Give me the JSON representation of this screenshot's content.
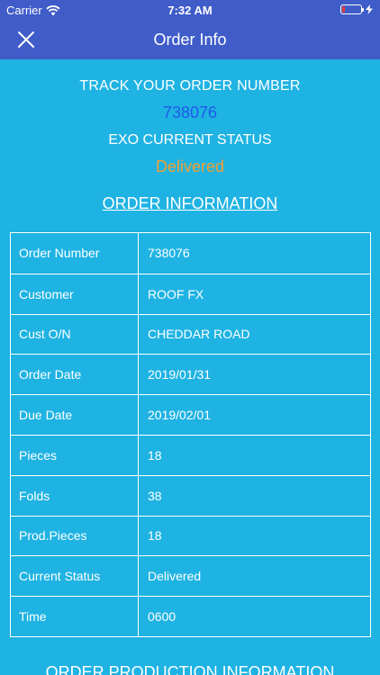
{
  "status_bar": {
    "carrier": "Carrier",
    "time": "7:32 AM",
    "battery_level": 0.15,
    "icons": [
      "wifi-icon",
      "battery-icon",
      "charging-icon"
    ]
  },
  "nav": {
    "title": "Order Info",
    "close_icon": "close-icon"
  },
  "tracking": {
    "label": "TRACK YOUR ORDER NUMBER",
    "number": "738076",
    "status_label": "EXO CURRENT STATUS",
    "status_value": "Delivered"
  },
  "order_info": {
    "title": "ORDER INFORMATION",
    "rows": [
      {
        "label": "Order Number",
        "value": "738076"
      },
      {
        "label": "Customer",
        "value": "ROOF FX"
      },
      {
        "label": "Cust O/N",
        "value": "CHEDDAR ROAD"
      },
      {
        "label": "Order Date",
        "value": "2019/01/31"
      },
      {
        "label": "Due Date",
        "value": "2019/02/01"
      },
      {
        "label": "Pieces",
        "value": "18"
      },
      {
        "label": "Folds",
        "value": "38"
      },
      {
        "label": "Prod.Pieces",
        "value": "18"
      },
      {
        "label": "Current Status",
        "value": "Delivered"
      },
      {
        "label": "Time",
        "value": "0600"
      }
    ]
  },
  "production_info": {
    "title": "ORDER PRODUCTION INFORMATION"
  },
  "colors": {
    "background": "#1fb3e3",
    "nav": "#3f5cc9",
    "order_number": "#1e5be8",
    "status_value": "#f0a030",
    "battery_low": "#e83b3b"
  }
}
